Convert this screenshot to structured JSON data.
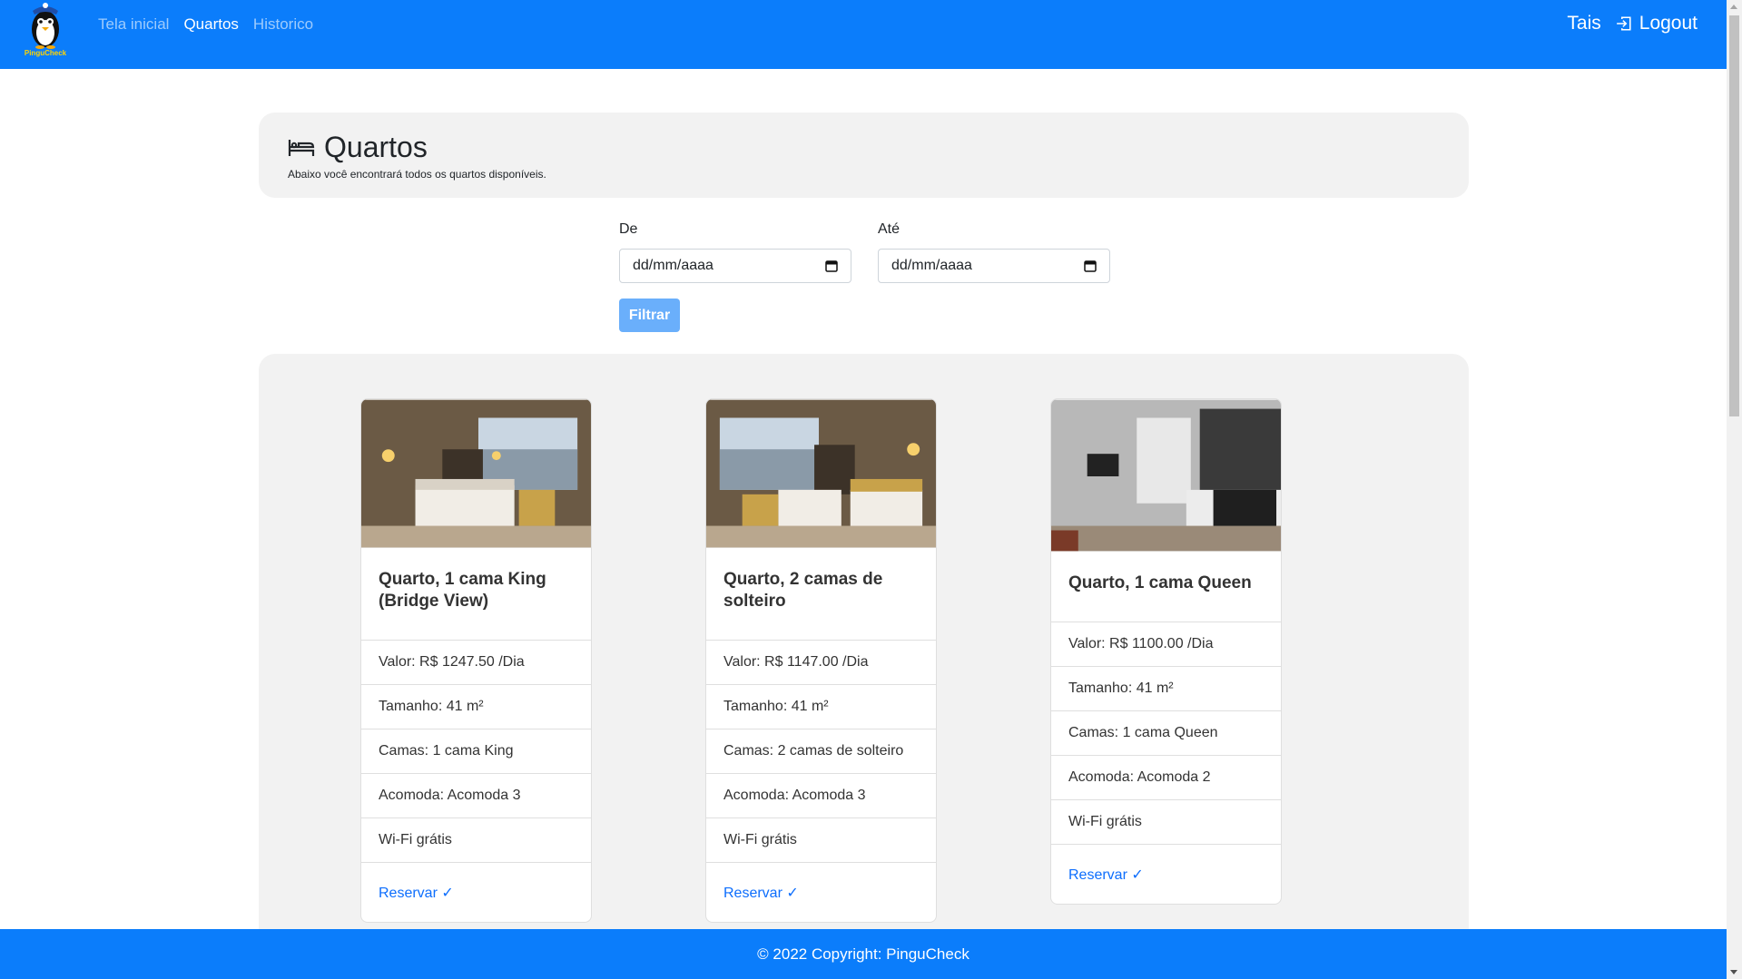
{
  "brand": {
    "logo_text": "PinguCheck"
  },
  "nav": {
    "links": [
      {
        "label": "Tela inicial",
        "active": false
      },
      {
        "label": "Quartos",
        "active": true
      },
      {
        "label": "Historico",
        "active": false
      }
    ],
    "user": "Tais",
    "logout_label": "Logout"
  },
  "header": {
    "title": "Quartos",
    "subtitle": "Abaixo você encontrará todos os quartos disponíveis."
  },
  "filter": {
    "from_label": "De",
    "from_value": "dd/mm/aaaa",
    "to_label": "Até",
    "to_value": "dd/mm/aaaa",
    "button_label": "Filtrar"
  },
  "rooms": [
    {
      "title": "Quarto, 1 cama King (Bridge View)",
      "valor": "Valor: R$ 1247.50 /Dia",
      "tamanho": "Tamanho: 41 m²",
      "camas": "Camas: 1 cama King",
      "acomoda": "Acomoda: Acomoda 3",
      "wifi": "Wi-Fi grátis",
      "reserve_label": "Reservar ✓"
    },
    {
      "title": "Quarto, 2 camas de solteiro",
      "valor": "Valor: R$ 1147.00 /Dia",
      "tamanho": "Tamanho: 41 m²",
      "camas": "Camas: 2 camas de solteiro",
      "acomoda": "Acomoda: Acomoda 3",
      "wifi": "Wi-Fi grátis",
      "reserve_label": "Reservar ✓"
    },
    {
      "title": "Quarto, 1 cama Queen",
      "valor": "Valor: R$ 1100.00 /Dia",
      "tamanho": "Tamanho: 41 m²",
      "camas": "Camas: 1 cama Queen",
      "acomoda": "Acomoda: Acomoda 2",
      "wifi": "Wi-Fi grátis",
      "reserve_label": "Reservar ✓"
    }
  ],
  "footer": {
    "text": "© 2022 Copyright: PinguCheck"
  },
  "colors": {
    "primary": "#0b7dfb",
    "panel": "#f2f2f2",
    "link": "#0d6efd"
  },
  "icons": {
    "logout": "box-arrow-in-right-icon",
    "header": "bed-icon",
    "calendar": "calendar-icon"
  }
}
